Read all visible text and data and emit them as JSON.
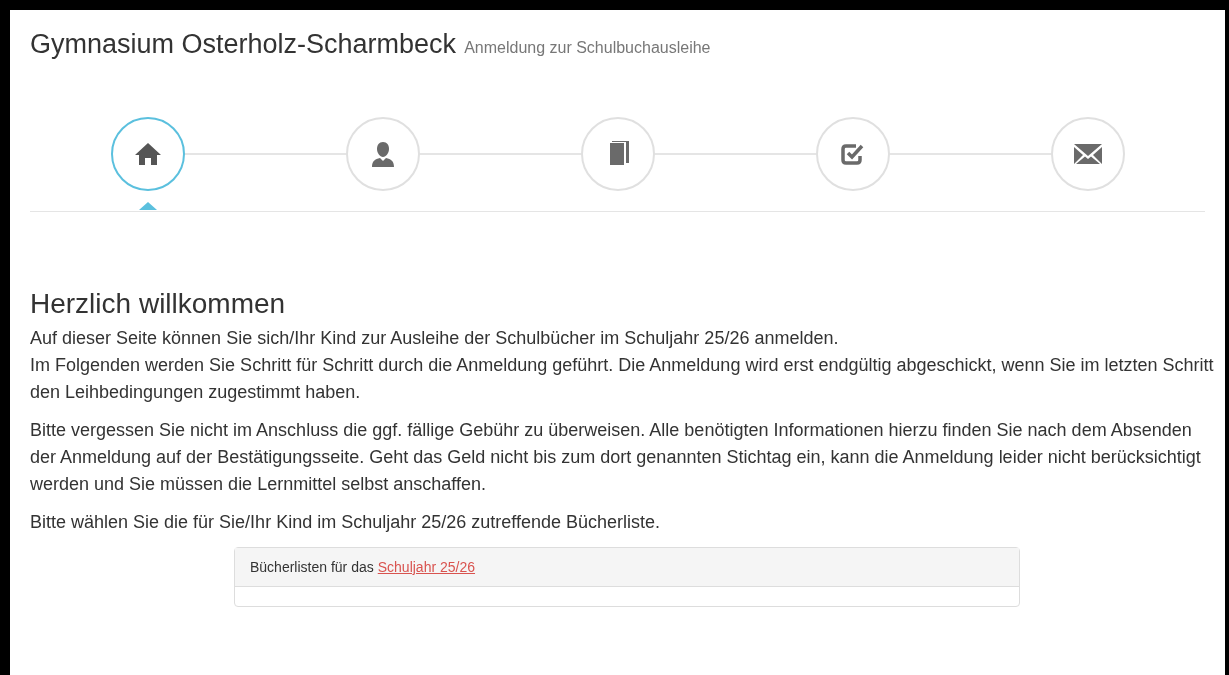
{
  "header": {
    "title": "Gymnasium Osterholz-Scharmbeck",
    "subtitle": "Anmeldung zur Schulbuchausleihe"
  },
  "steps": [
    {
      "kind": "home",
      "selected": true
    },
    {
      "kind": "person",
      "selected": false
    },
    {
      "kind": "book",
      "selected": false
    },
    {
      "kind": "check",
      "selected": false
    },
    {
      "kind": "envelope",
      "selected": false
    }
  ],
  "heading": "Herzlich willkommen",
  "paragraphs": [
    [
      "Auf dieser Seite können Sie sich/Ihr Kind zur Ausleihe der Schulbücher im Schuljahr 25/26 anmelden.",
      "Im Folgenden werden Sie Schritt für Schritt durch die Anmeldung geführt. Die Anmeldung wird erst endgültig abgeschickt, wenn Sie im letzten Schritt den Leihbedingungen zugestimmt haben."
    ],
    [
      "Bitte vergessen Sie nicht im Anschluss die ggf. fällige Gebühr zu überweisen. Alle benötigten Informationen hierzu finden Sie nach dem Absenden der Anmeldung auf der Bestätigungsseite. Geht das Geld nicht bis zum dort genannten Stichtag ein, kann die Anmeldung leider nicht berücksichtigt werden und Sie müssen die Lernmittel selbst anschaffen."
    ],
    [
      "Bitte wählen Sie die für Sie/Ihr Kind im Schuljahr 25/26 zutreffende Bücherliste."
    ]
  ],
  "panel": {
    "title": "Bücherlisten für das",
    "link": "Schuljahr 25/26"
  }
}
